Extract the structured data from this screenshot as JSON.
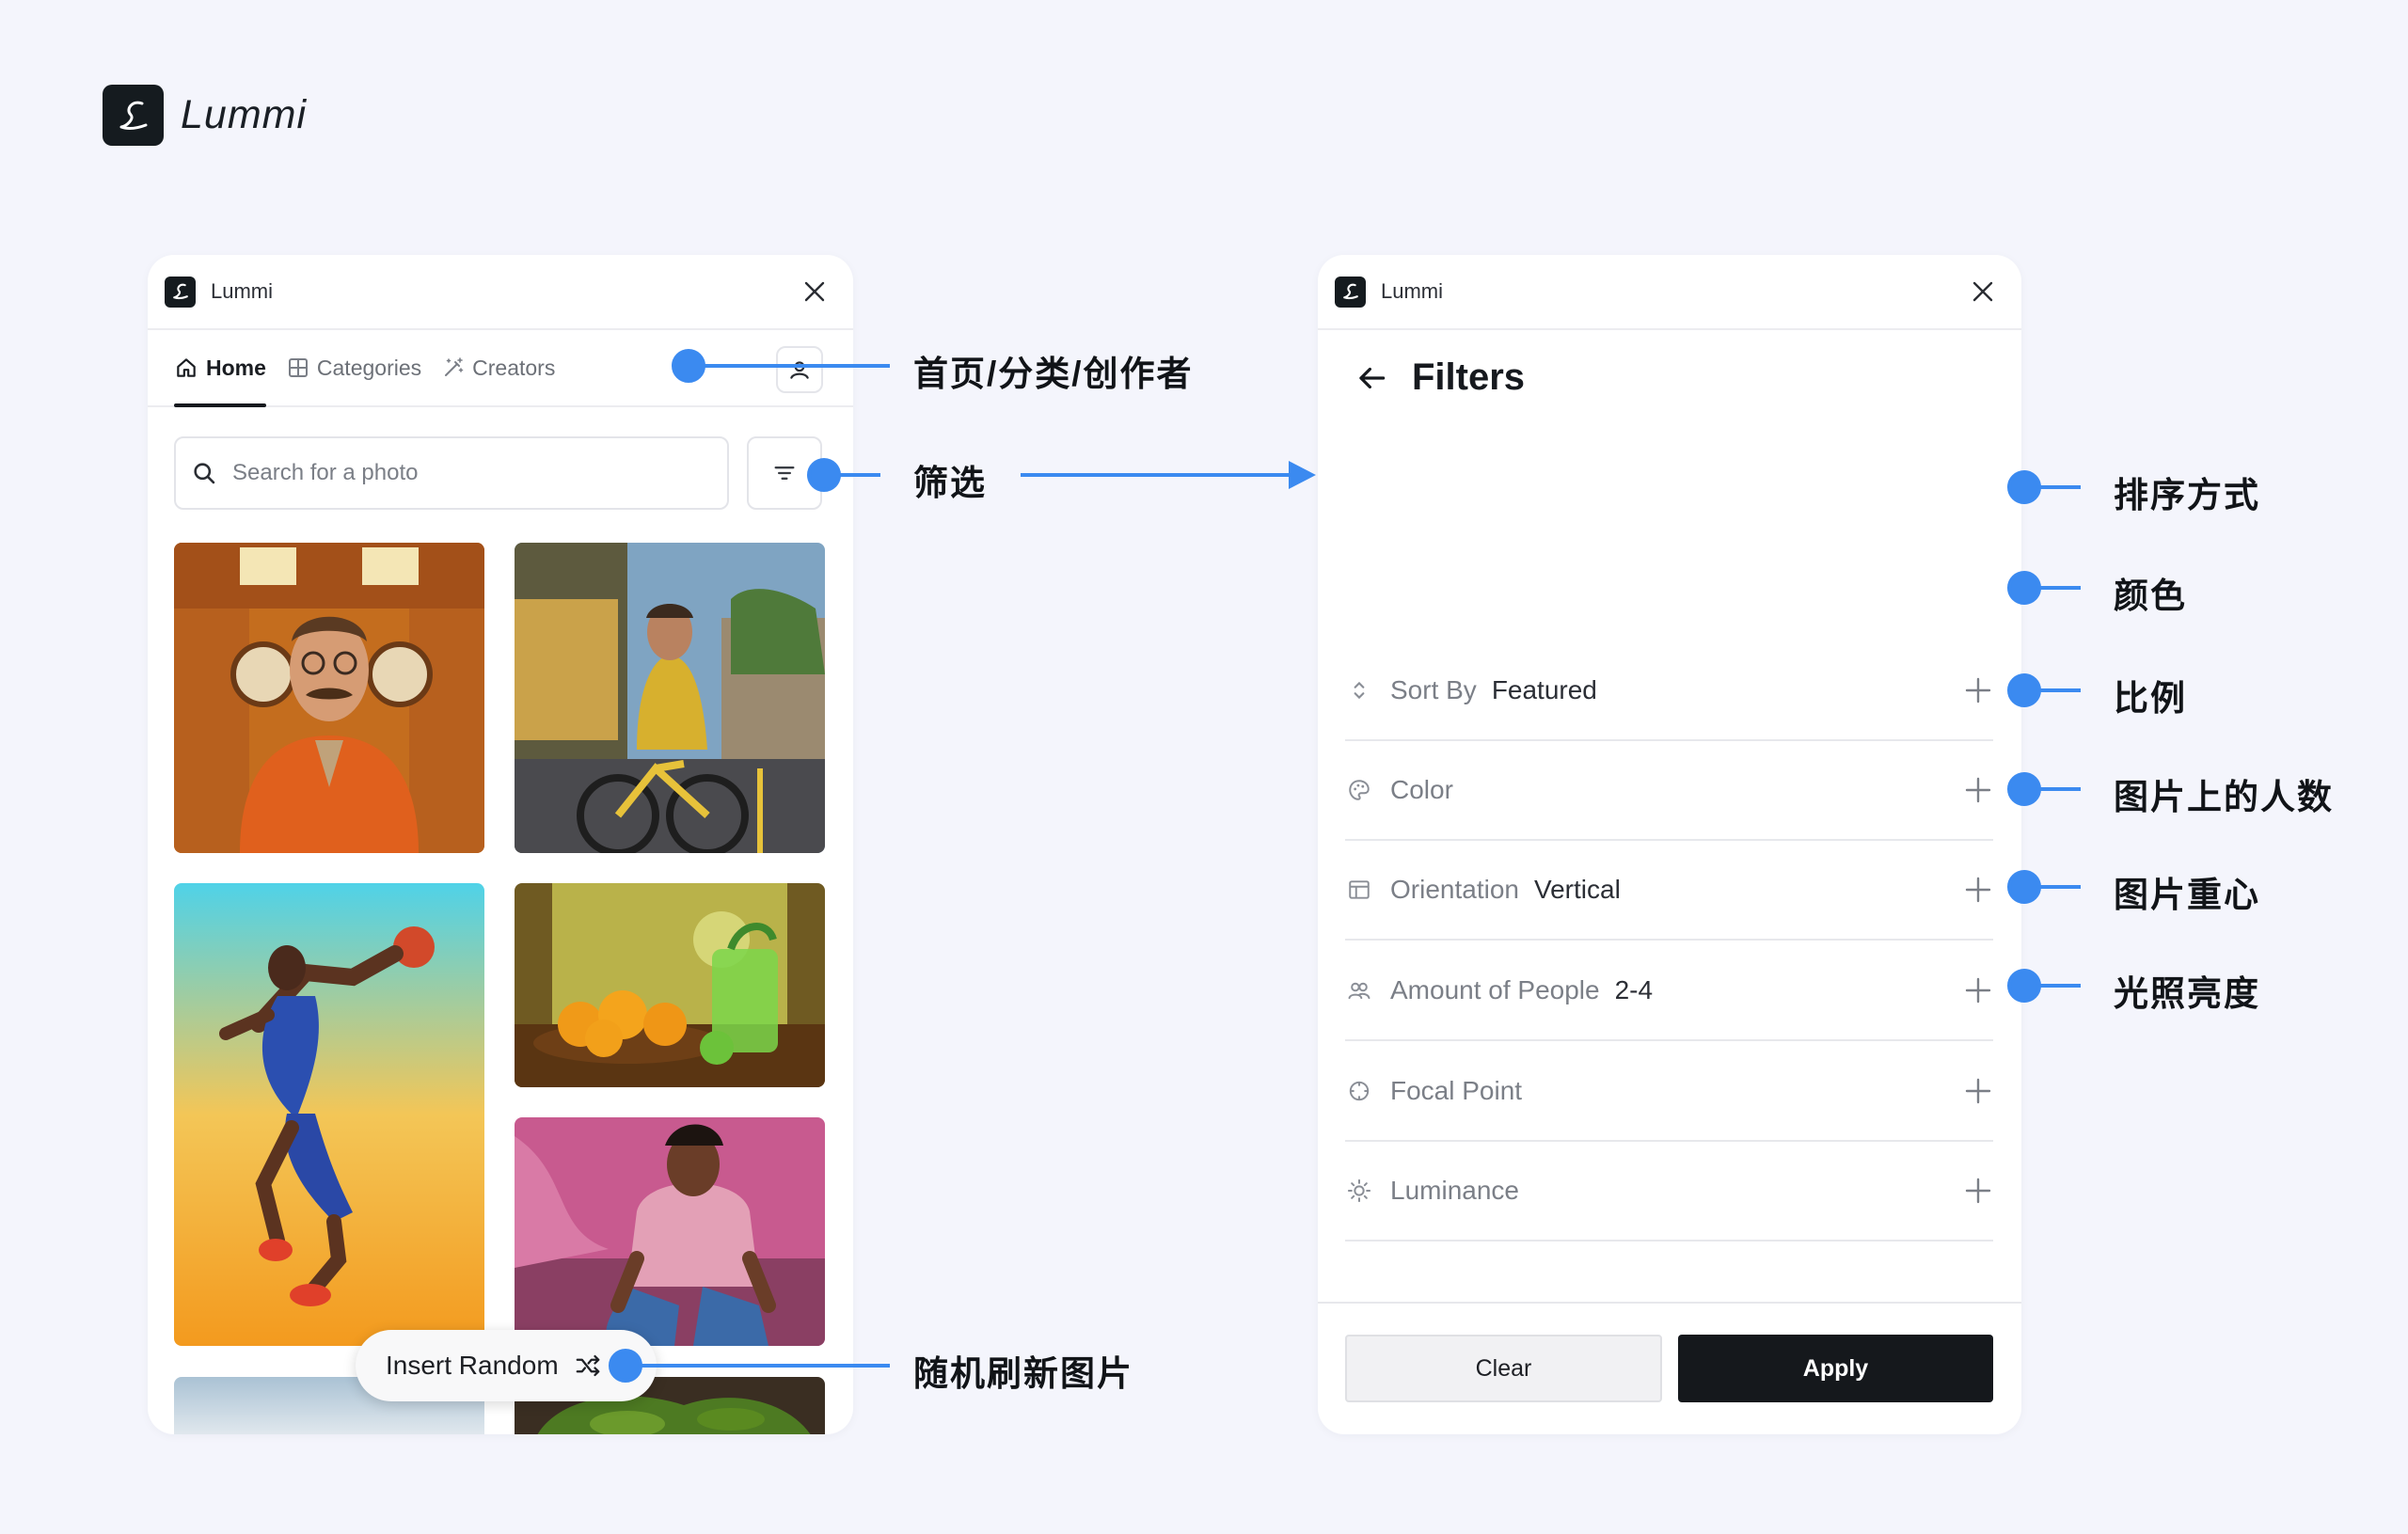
{
  "brand": {
    "name": "Lummi",
    "logo_icon": "script-l-logo-icon"
  },
  "left_panel": {
    "title": "Lummi",
    "tabs": [
      {
        "label": "Home",
        "icon": "home-icon",
        "active": true
      },
      {
        "label": "Categories",
        "icon": "grid-icon",
        "active": false
      },
      {
        "label": "Creators",
        "icon": "magic-wand-icon",
        "active": false
      }
    ],
    "search": {
      "placeholder": "Search for a photo",
      "value": ""
    },
    "photos": [
      {
        "subject": "man-in-orange-suit"
      },
      {
        "subject": "cyclist-on-street"
      },
      {
        "subject": "basketball-player-jumping"
      },
      {
        "subject": "oranges-and-lime-drink"
      },
      {
        "subject": "man-in-pink-shirt"
      },
      {
        "subject": "sky-landscape"
      },
      {
        "subject": "vegetable-dish"
      }
    ],
    "insert_random_label": "Insert Random"
  },
  "right_panel": {
    "title": "Lummi",
    "heading": "Filters",
    "rows": [
      {
        "label": "Sort By",
        "value": "Featured",
        "icon": "sort-arrows-icon"
      },
      {
        "label": "Color",
        "value": "",
        "icon": "palette-icon"
      },
      {
        "label": "Orientation",
        "value": "Vertical",
        "icon": "layout-icon"
      },
      {
        "label": "Amount of People",
        "value": "2-4",
        "icon": "people-icon"
      },
      {
        "label": "Focal Point",
        "value": "",
        "icon": "target-icon"
      },
      {
        "label": "Luminance",
        "value": "",
        "icon": "sun-icon"
      }
    ],
    "clear_label": "Clear",
    "apply_label": "Apply"
  },
  "annotations": {
    "tabs": "首页/分类/创作者",
    "filter": "筛选",
    "sort": "排序方式",
    "color": "颜色",
    "ratio": "比例",
    "people": "图片上的人数",
    "focal": "图片重心",
    "luminance": "光照亮度",
    "random": "随机刷新图片"
  },
  "colors": {
    "background": "#f4f5fc",
    "accent_blue": "#3b8af0",
    "dark": "#15181c"
  }
}
